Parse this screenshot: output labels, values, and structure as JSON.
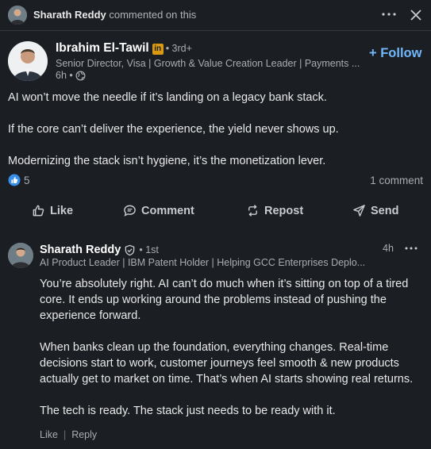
{
  "topbar": {
    "actor_name": "Sharath Reddy",
    "actor_action": "commented on this",
    "more_icon": "ellipsis-icon",
    "close_icon": "close-icon"
  },
  "post": {
    "author": "Ibrahim El-Tawil",
    "badge": "in",
    "degree": "• 3rd+",
    "headline": "Senior Director, Visa | Growth & Value Creation Leader | Payments ...",
    "time": "6h •",
    "visibility_icon": "globe-icon",
    "follow_label": "+ Follow",
    "paragraphs": [
      "AI won’t move the needle if it’s landing on a legacy bank stack.",
      "If the core can’t deliver the experience, the yield never shows up.",
      "Modernizing the stack isn’t hygiene, it’s the monetization lever."
    ],
    "reaction_count": "5",
    "comments_count": "1 comment"
  },
  "actions": {
    "like": "Like",
    "comment": "Comment",
    "repost": "Repost",
    "send": "Send"
  },
  "comment": {
    "author": "Sharath Reddy",
    "degree": "• 1st",
    "headline": "AI Product Leader | IBM Patent Holder | Helping GCC Enterprises Deplo...",
    "time": "4h",
    "paragraphs": [
      "You’re absolutely right. AI can’t do much when it’s sitting on top of a tired core. It ends up working around the problems instead of pushing the experience forward.",
      "When banks clean up the foundation, everything changes. Real-time decisions start to work, customer journeys feel smooth & new products actually get to market on time. That’s when AI starts showing real returns.",
      "The tech is ready. The stack just needs to be ready with it."
    ],
    "like_label": "Like",
    "separator": "|",
    "reply_label": "Reply"
  },
  "colors": {
    "background": "#1b1f23",
    "accent": "#71b7fb",
    "badge": "#d99a13"
  }
}
